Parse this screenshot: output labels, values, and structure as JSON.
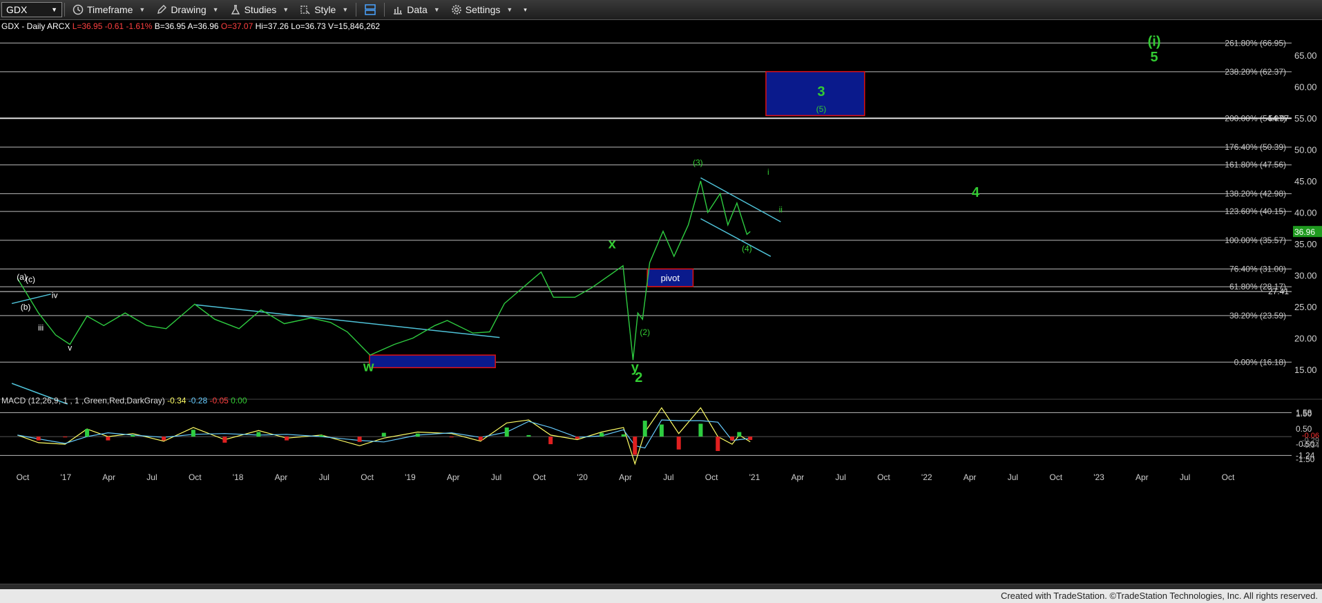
{
  "toolbar": {
    "symbol": "GDX",
    "timeframe": "Timeframe",
    "drawing": "Drawing",
    "studies": "Studies",
    "style": "Style",
    "data": "Data",
    "settings": "Settings"
  },
  "header": {
    "symbol_line": "GDX - Daily  ARCX",
    "quotes": [
      {
        "text": "L=36.95",
        "color": "#ff4040"
      },
      {
        "text": "-0.61",
        "color": "#ff4040"
      },
      {
        "text": "-1.61%",
        "color": "#ff4040"
      },
      {
        "text": "B=36.95",
        "color": "#ffffff"
      },
      {
        "text": "A=36.96",
        "color": "#ffffff"
      },
      {
        "text": "O=37.07",
        "color": "#ff4040"
      },
      {
        "text": "Hi=37.26",
        "color": "#ffffff"
      },
      {
        "text": "Lo=36.73",
        "color": "#ffffff"
      },
      {
        "text": "V=15,846,262",
        "color": "#ffffff"
      }
    ]
  },
  "macd_header": {
    "label": "MACD (12,26,9, 1 , 1 ,Green,Red,DarkGray)",
    "values": [
      {
        "text": "-0.34",
        "color": "#ffff66"
      },
      {
        "text": "-0.28",
        "color": "#66ccff"
      },
      {
        "text": "-0.05",
        "color": "#ff4040"
      },
      {
        "text": "0.00",
        "color": "#33cc33"
      }
    ]
  },
  "chart_data": {
    "type": "line",
    "title": "GDX - Daily",
    "ylim": [
      12,
      68
    ],
    "price_axis_ticks": [
      15,
      20,
      25,
      30,
      35,
      40,
      45,
      50,
      55,
      60,
      65
    ],
    "last_price": "36.96",
    "x_tick_labels": [
      "Oct",
      "'17",
      "Apr",
      "Jul",
      "Oct",
      "'18",
      "Apr",
      "Jul",
      "Oct",
      "'19",
      "Apr",
      "Jul",
      "Oct",
      "'20",
      "Apr",
      "Jul",
      "Oct",
      "'21",
      "Apr",
      "Jul",
      "Oct",
      "'22",
      "Apr",
      "Jul",
      "Oct",
      "'23",
      "Apr",
      "Jul",
      "Oct"
    ],
    "fib_levels": [
      {
        "label": "261.80% (66.95)",
        "value": 66.95
      },
      {
        "label": "238.20% (62.37)",
        "value": 62.37
      },
      {
        "label": "200.00% (54.97)",
        "value": 54.97
      },
      {
        "label": "176.40% (50.39)",
        "value": 50.39
      },
      {
        "label": "161.80% (47.56)",
        "value": 47.56
      },
      {
        "label": "138.20% (42.98)",
        "value": 42.98
      },
      {
        "label": "123.60% (40.15)",
        "value": 40.15
      },
      {
        "label": "100.00% (35.57)",
        "value": 35.57
      },
      {
        "label": "76.40% (31.00)",
        "value": 31.0
      },
      {
        "label": "61.80% (28.17)",
        "value": 28.17
      },
      {
        "label": "38.20% (23.59)",
        "value": 23.59
      },
      {
        "label": "0.00% (16.18)",
        "value": 16.18
      }
    ],
    "horizontal_levels": [
      {
        "label": "54.97",
        "value": 54.97
      },
      {
        "label": "27.41",
        "value": 27.41
      }
    ],
    "price_series": [
      {
        "x": "2016-09-01",
        "y": 29.5
      },
      {
        "x": "2016-10-15",
        "y": 24.0
      },
      {
        "x": "2016-11-20",
        "y": 20.5
      },
      {
        "x": "2016-12-20",
        "y": 19.0
      },
      {
        "x": "2017-01-25",
        "y": 23.5
      },
      {
        "x": "2017-03-01",
        "y": 22.0
      },
      {
        "x": "2017-04-15",
        "y": 24.0
      },
      {
        "x": "2017-05-30",
        "y": 22.0
      },
      {
        "x": "2017-07-10",
        "y": 21.5
      },
      {
        "x": "2017-09-08",
        "y": 25.4
      },
      {
        "x": "2017-10-20",
        "y": 23.0
      },
      {
        "x": "2017-12-10",
        "y": 21.5
      },
      {
        "x": "2018-01-25",
        "y": 24.5
      },
      {
        "x": "2018-03-15",
        "y": 22.3
      },
      {
        "x": "2018-05-10",
        "y": 23.2
      },
      {
        "x": "2018-06-20",
        "y": 22.5
      },
      {
        "x": "2018-07-25",
        "y": 21.0
      },
      {
        "x": "2018-09-11",
        "y": 17.3
      },
      {
        "x": "2018-11-01",
        "y": 19.0
      },
      {
        "x": "2018-12-10",
        "y": 20.0
      },
      {
        "x": "2019-01-25",
        "y": 22.0
      },
      {
        "x": "2019-02-20",
        "y": 22.8
      },
      {
        "x": "2019-04-15",
        "y": 20.8
      },
      {
        "x": "2019-05-20",
        "y": 21.0
      },
      {
        "x": "2019-06-20",
        "y": 25.5
      },
      {
        "x": "2019-08-05",
        "y": 28.5
      },
      {
        "x": "2019-09-05",
        "y": 30.5
      },
      {
        "x": "2019-10-01",
        "y": 26.5
      },
      {
        "x": "2019-11-15",
        "y": 26.5
      },
      {
        "x": "2019-12-20",
        "y": 28.0
      },
      {
        "x": "2020-02-24",
        "y": 31.5
      },
      {
        "x": "2020-03-16",
        "y": 16.5
      },
      {
        "x": "2020-03-26",
        "y": 24.0
      },
      {
        "x": "2020-04-05",
        "y": 23.0
      },
      {
        "x": "2020-04-20",
        "y": 32.0
      },
      {
        "x": "2020-05-18",
        "y": 37.0
      },
      {
        "x": "2020-06-10",
        "y": 33.0
      },
      {
        "x": "2020-07-10",
        "y": 38.0
      },
      {
        "x": "2020-08-05",
        "y": 45.0
      },
      {
        "x": "2020-08-20",
        "y": 40.0
      },
      {
        "x": "2020-09-15",
        "y": 43.0
      },
      {
        "x": "2020-10-01",
        "y": 38.0
      },
      {
        "x": "2020-10-20",
        "y": 41.5
      },
      {
        "x": "2020-11-10",
        "y": 36.5
      },
      {
        "x": "2020-11-17",
        "y": 36.96
      }
    ],
    "trendlines": [
      {
        "from": {
          "x": "2017-09-10",
          "y": 25.3
        },
        "to": {
          "x": "2019-06-10",
          "y": 20.1
        }
      },
      {
        "from": {
          "x": "2016-08-20",
          "y": 25.5
        },
        "to": {
          "x": "2016-11-10",
          "y": 27.0
        }
      },
      {
        "from": {
          "x": "2020-08-05",
          "y": 45.5
        },
        "to": {
          "x": "2021-01-20",
          "y": 38.5
        }
      },
      {
        "from": {
          "x": "2020-08-05",
          "y": 39.0
        },
        "to": {
          "x": "2020-12-30",
          "y": 33.0
        }
      },
      {
        "from": {
          "x": "2016-08-20",
          "y": 11.0
        },
        "to": {
          "x": "2016-12-15",
          "y": 8.0
        }
      }
    ],
    "boxes": [
      {
        "label": "",
        "from": {
          "x": "2018-09-10",
          "y": 17.3
        },
        "to": {
          "x": "2019-06-01",
          "y": 15.3
        }
      },
      {
        "label": "pivot",
        "from": {
          "x": "2020-04-15",
          "y": 31.0
        },
        "to": {
          "x": "2020-07-20",
          "y": 28.2
        }
      },
      {
        "label": "",
        "from": {
          "x": "2020-12-20",
          "y": 62.4
        },
        "to": {
          "x": "2021-07-15",
          "y": 55.4
        }
      }
    ],
    "wave_labels": [
      {
        "text": "(i)",
        "x": "2023-03-15",
        "y": 66.5,
        "color": "#33cc33",
        "size": "large"
      },
      {
        "text": "5",
        "x": "2023-03-15",
        "y": 64.0,
        "color": "#33cc33",
        "size": "large"
      },
      {
        "text": "3",
        "x": "2021-04-15",
        "y": 58.5,
        "color": "#33cc33",
        "size": "large"
      },
      {
        "text": "(5)",
        "x": "2021-04-15",
        "y": 56.0,
        "color": "#33cc33",
        "size": "small"
      },
      {
        "text": "4",
        "x": "2022-03-05",
        "y": 42.5,
        "color": "#33cc33",
        "size": "large"
      },
      {
        "text": "(3)",
        "x": "2020-07-30",
        "y": 47.5,
        "color": "#33cc33",
        "size": "small"
      },
      {
        "text": "i",
        "x": "2020-12-25",
        "y": 46.0,
        "color": "#33cc33",
        "size": "small"
      },
      {
        "text": "ii",
        "x": "2021-01-20",
        "y": 40.0,
        "color": "#33cc33",
        "size": "small"
      },
      {
        "text": "(4)",
        "x": "2020-11-10",
        "y": 33.8,
        "color": "#33cc33",
        "size": "small"
      },
      {
        "text": "x",
        "x": "2020-02-01",
        "y": 34.3,
        "color": "#33cc33",
        "size": "large"
      },
      {
        "text": "(2)",
        "x": "2020-04-10",
        "y": 20.5,
        "color": "#33cc33",
        "size": "small"
      },
      {
        "text": "y",
        "x": "2020-03-20",
        "y": 14.6,
        "color": "#33cc33",
        "size": "large"
      },
      {
        "text": "2",
        "x": "2020-03-28",
        "y": 13.0,
        "color": "#33cc33",
        "size": "large"
      },
      {
        "text": "w",
        "x": "2018-09-08",
        "y": 14.7,
        "color": "#33cc33",
        "size": "large"
      },
      {
        "text": "(a)",
        "x": "2016-09-10",
        "y": 29.3,
        "color": "#ffffff",
        "size": "small"
      },
      {
        "text": "(c)",
        "x": "2016-09-28",
        "y": 28.9,
        "color": "#ffffff",
        "size": "small"
      },
      {
        "text": "(b)",
        "x": "2016-09-18",
        "y": 24.5,
        "color": "#ffffff",
        "size": "small"
      },
      {
        "text": "iv",
        "x": "2016-11-18",
        "y": 26.4,
        "color": "#ffffff",
        "size": "small"
      },
      {
        "text": "iii",
        "x": "2016-10-20",
        "y": 21.2,
        "color": "#ffffff",
        "size": "small"
      },
      {
        "text": "v",
        "x": "2016-12-20",
        "y": 18.0,
        "color": "#ffffff",
        "size": "small"
      }
    ],
    "macd": {
      "ylim": [
        -2.0,
        2.1
      ],
      "ticks": [
        {
          "label": "1.58",
          "value": 1.58
        },
        {
          "label": "1.50",
          "value": 1.5
        },
        {
          "label": "0.50",
          "value": 0.5
        },
        {
          "label": "-0.50",
          "value": -0.5
        },
        {
          "label": "-1.24",
          "value": -1.24
        },
        {
          "label": "-1.50",
          "value": -1.5
        }
      ],
      "value_badges": [
        {
          "label": "-0.06",
          "color": "#ff3030"
        },
        {
          "label": "-0.29",
          "color": "#888888"
        },
        {
          "label": "-0.34",
          "color": "#aaaaaa"
        }
      ],
      "reference_levels": [
        1.58,
        -1.24
      ],
      "macd_series": [
        {
          "x": "2016-09-01",
          "y": 0.1
        },
        {
          "x": "2016-10-15",
          "y": -0.4
        },
        {
          "x": "2016-12-10",
          "y": -0.5
        },
        {
          "x": "2017-01-25",
          "y": 0.5
        },
        {
          "x": "2017-03-10",
          "y": 0.0
        },
        {
          "x": "2017-05-01",
          "y": 0.2
        },
        {
          "x": "2017-07-05",
          "y": -0.3
        },
        {
          "x": "2017-09-05",
          "y": 0.6
        },
        {
          "x": "2017-11-10",
          "y": -0.2
        },
        {
          "x": "2018-01-20",
          "y": 0.4
        },
        {
          "x": "2018-03-20",
          "y": -0.1
        },
        {
          "x": "2018-06-01",
          "y": 0.1
        },
        {
          "x": "2018-08-20",
          "y": -0.6
        },
        {
          "x": "2018-10-10",
          "y": -0.1
        },
        {
          "x": "2018-12-20",
          "y": 0.3
        },
        {
          "x": "2019-03-01",
          "y": 0.2
        },
        {
          "x": "2019-05-01",
          "y": -0.3
        },
        {
          "x": "2019-06-25",
          "y": 0.9
        },
        {
          "x": "2019-08-10",
          "y": 1.1
        },
        {
          "x": "2019-09-25",
          "y": 0.1
        },
        {
          "x": "2019-11-20",
          "y": -0.2
        },
        {
          "x": "2020-01-10",
          "y": 0.3
        },
        {
          "x": "2020-02-25",
          "y": 0.6
        },
        {
          "x": "2020-03-20",
          "y": -1.8
        },
        {
          "x": "2020-04-10",
          "y": 0.3
        },
        {
          "x": "2020-05-15",
          "y": 1.9
        },
        {
          "x": "2020-06-20",
          "y": 0.2
        },
        {
          "x": "2020-08-05",
          "y": 1.9
        },
        {
          "x": "2020-09-10",
          "y": 0.0
        },
        {
          "x": "2020-10-10",
          "y": -0.5
        },
        {
          "x": "2020-10-25",
          "y": 0.1
        },
        {
          "x": "2020-11-17",
          "y": -0.34
        }
      ]
    }
  },
  "footer": "Created with TradeStation. ©TradeStation Technologies, Inc. All rights reserved."
}
